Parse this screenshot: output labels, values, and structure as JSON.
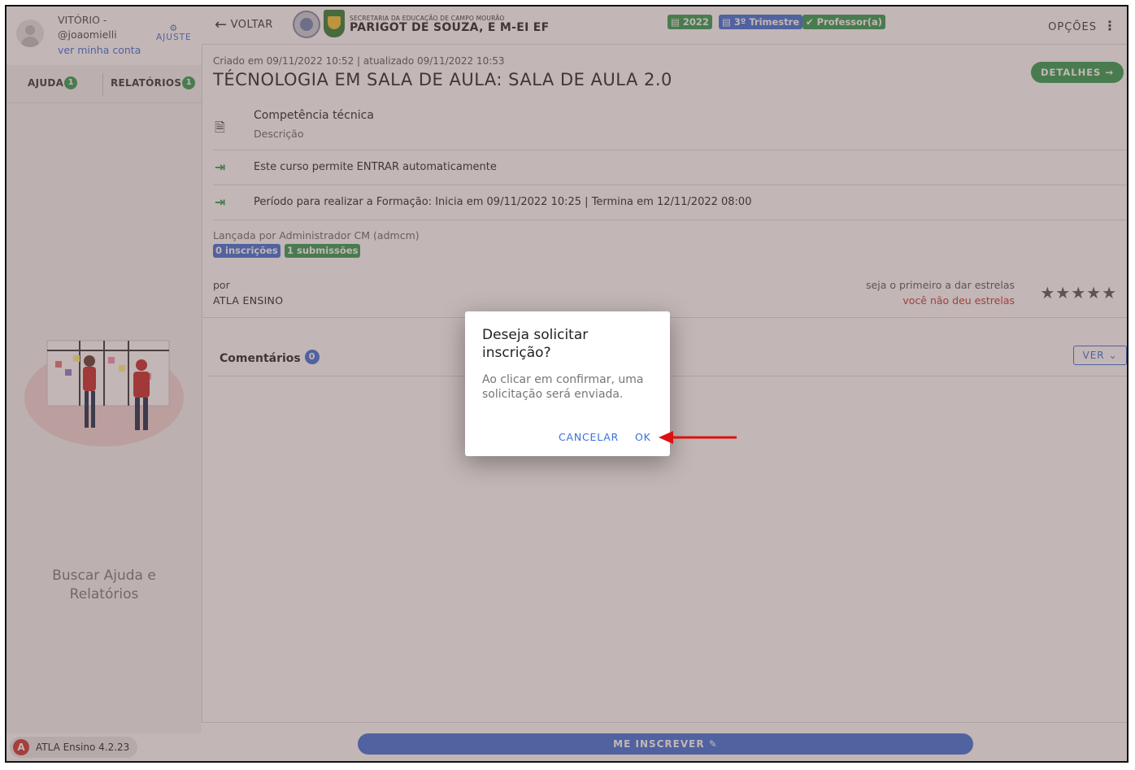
{
  "user": {
    "name_line1": "VITÓRIO -",
    "name_line2": "@joaomielli",
    "account_link": "ver minha conta",
    "adjust_label": "AJUSTE"
  },
  "sidebar": {
    "tabs": [
      {
        "label": "AJUDA",
        "count": "1"
      },
      {
        "label": "RELATÓRIOS",
        "count": "1"
      }
    ],
    "help_text_line1": "Buscar Ajuda e",
    "help_text_line2": "Relatórios",
    "version": "ATLA Ensino 4.2.23"
  },
  "topbar": {
    "back_label": "VOLTAR",
    "school_sub": "SECRETARIA DA EDUCAÇÃO DE CAMPO MOURÃO",
    "school_name": "PARIGOT DE SOUZA, E M-EI EF",
    "chips": {
      "year": "2022",
      "trimester": "3º Trimestre",
      "role": "Professor(a)"
    },
    "options_label": "OPÇÕES"
  },
  "course": {
    "meta": "Criado em 09/11/2022 10:52 | atualizado 09/11/2022 10:53",
    "title": "TÉCNOLOGIA EM SALA DE AULA: SALA DE AULA 2.0",
    "details_label": "DETALHES",
    "competence": "Competência técnica",
    "description_label": "Descrição",
    "auto_enter": "Este curso permite ENTRAR automaticamente",
    "period": "Período para realizar a Formação: Inicia em 09/11/2022 10:25 | Termina em 12/11/2022 08:00",
    "launched_by": "Lançada por Administrador CM (admcm)",
    "enrollments_tag": "0 inscrições",
    "submissions_tag": "1 submissões",
    "by_label": "por",
    "by_name": "ATLA ENSINO",
    "stars_hint": "seja o primeiro a dar estrelas",
    "stars_none": "você não deu estrelas",
    "stars_filled": 0,
    "stars_total": 5
  },
  "comments": {
    "label": "Comentários",
    "count": "0",
    "ver_label": "VER"
  },
  "bottom": {
    "enroll_label": "ME INSCREVER"
  },
  "dialog": {
    "title": "Deseja solicitar inscrição?",
    "body": "Ao clicar em confirmar, uma solicitação será enviada.",
    "cancel_label": "CANCELAR",
    "ok_label": "OK"
  },
  "colors": {
    "accent_blue": "#3c6fd8",
    "accent_green": "#2e9b4e",
    "alert_red": "#d32f2f"
  }
}
